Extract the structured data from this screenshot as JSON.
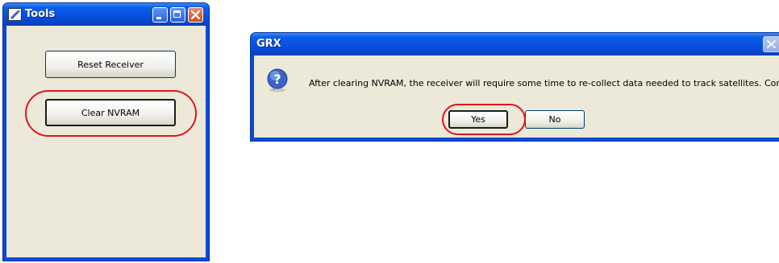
{
  "tools_window": {
    "title": "Tools",
    "app_icon": "tools-app-icon",
    "caption_buttons": [
      "minimize-icon",
      "maximize-icon",
      "close-icon"
    ],
    "buttons": {
      "reset_receiver": "Reset Receiver",
      "clear_nvram": "Clear NVRAM"
    }
  },
  "grx_dialog": {
    "title": "GRX",
    "icon": "question-icon",
    "message": "After clearing NVRAM, the receiver will require some time to re-collect data needed to track satellites. Continue?",
    "buttons": {
      "yes": "Yes",
      "no": "No"
    }
  },
  "colors": {
    "titlebar_blue": "#0751e0",
    "client_background": "#ece9d8",
    "highlight_red": "#e2141c",
    "close_red": "#d24a1d"
  }
}
